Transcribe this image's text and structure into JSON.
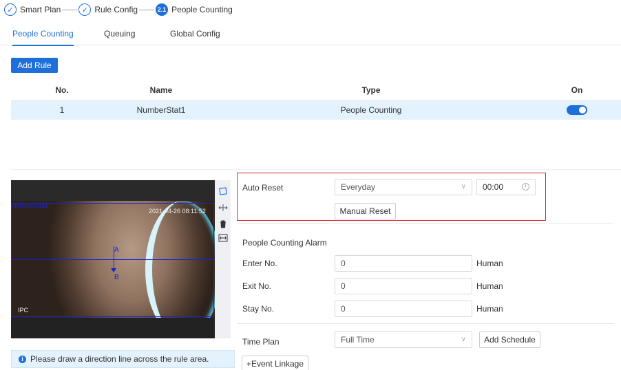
{
  "stepper": {
    "step1_label": "Smart Plan",
    "step2_label": "Rule Config",
    "step3_number": "2.1",
    "step3_label": "People Counting",
    "check_glyph": "✓"
  },
  "tabs": [
    {
      "label": "People Counting",
      "active": true
    },
    {
      "label": "Queuing",
      "active": false
    },
    {
      "label": "Global Config",
      "active": false
    }
  ],
  "add_rule_label": "Add Rule",
  "table": {
    "headers": [
      "No.",
      "Name",
      "Type",
      "On"
    ],
    "rows": [
      {
        "no": "1",
        "name": "NumberStat1",
        "type": "People Counting",
        "on": true
      }
    ]
  },
  "video": {
    "rule_name": "NumberStat1",
    "timestamp": "2021-04-26 08:11:52",
    "channel": "IPC",
    "label_a": "A",
    "label_b": "B"
  },
  "tools": [
    "draw-area-icon",
    "move-icon",
    "delete-icon",
    "line-size-icon"
  ],
  "hint_text": "Please draw a direction line across the rule area.",
  "settings": {
    "auto_reset_label": "Auto Reset",
    "auto_reset_value": "Everyday",
    "time_value": "00:00",
    "manual_reset_label": "Manual Reset",
    "alarm_label": "People Counting Alarm",
    "enter_label": "Enter No.",
    "enter_value": "0",
    "exit_label": "Exit No.",
    "exit_value": "0",
    "stay_label": "Stay No.",
    "stay_value": "0",
    "unit": "Human",
    "time_plan_label": "Time Plan",
    "time_plan_value": "Full Time",
    "add_schedule_label": "Add Schedule",
    "event_linkage_label": "+Event Linkage"
  },
  "colors": {
    "accent": "#1e6fd9",
    "row_highlight": "#e3f2fc",
    "highlight_border": "#d9232d"
  }
}
